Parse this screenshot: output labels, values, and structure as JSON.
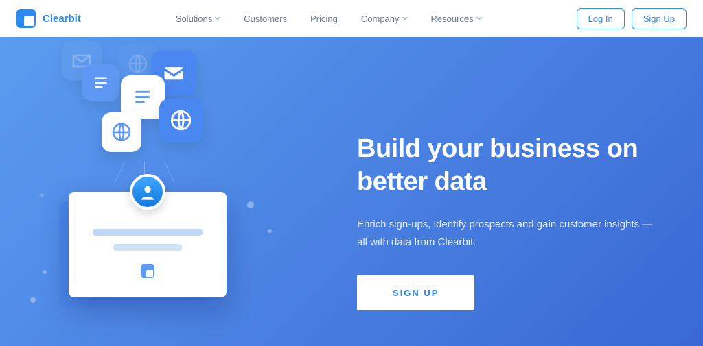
{
  "brand": {
    "name": "Clearbit"
  },
  "nav": {
    "items": [
      {
        "label": "Solutions",
        "has_dropdown": true
      },
      {
        "label": "Customers",
        "has_dropdown": false
      },
      {
        "label": "Pricing",
        "has_dropdown": false
      },
      {
        "label": "Company",
        "has_dropdown": true
      },
      {
        "label": "Resources",
        "has_dropdown": true
      }
    ],
    "login_label": "Log In",
    "signup_label": "Sign Up"
  },
  "hero": {
    "title": "Build your business on better data",
    "subtitle": "Enrich sign-ups, identify prospects and gain customer insights — all with data from Clearbit.",
    "cta_label": "SIGN UP"
  },
  "icons": {
    "mail": "mail-icon",
    "document": "document-icon",
    "globe": "globe-icon",
    "avatar": "avatar-icon"
  },
  "colors": {
    "brand_blue": "#2a8bf2",
    "hero_gradient_from": "#5b9cf0",
    "hero_gradient_to": "#3968d4"
  }
}
